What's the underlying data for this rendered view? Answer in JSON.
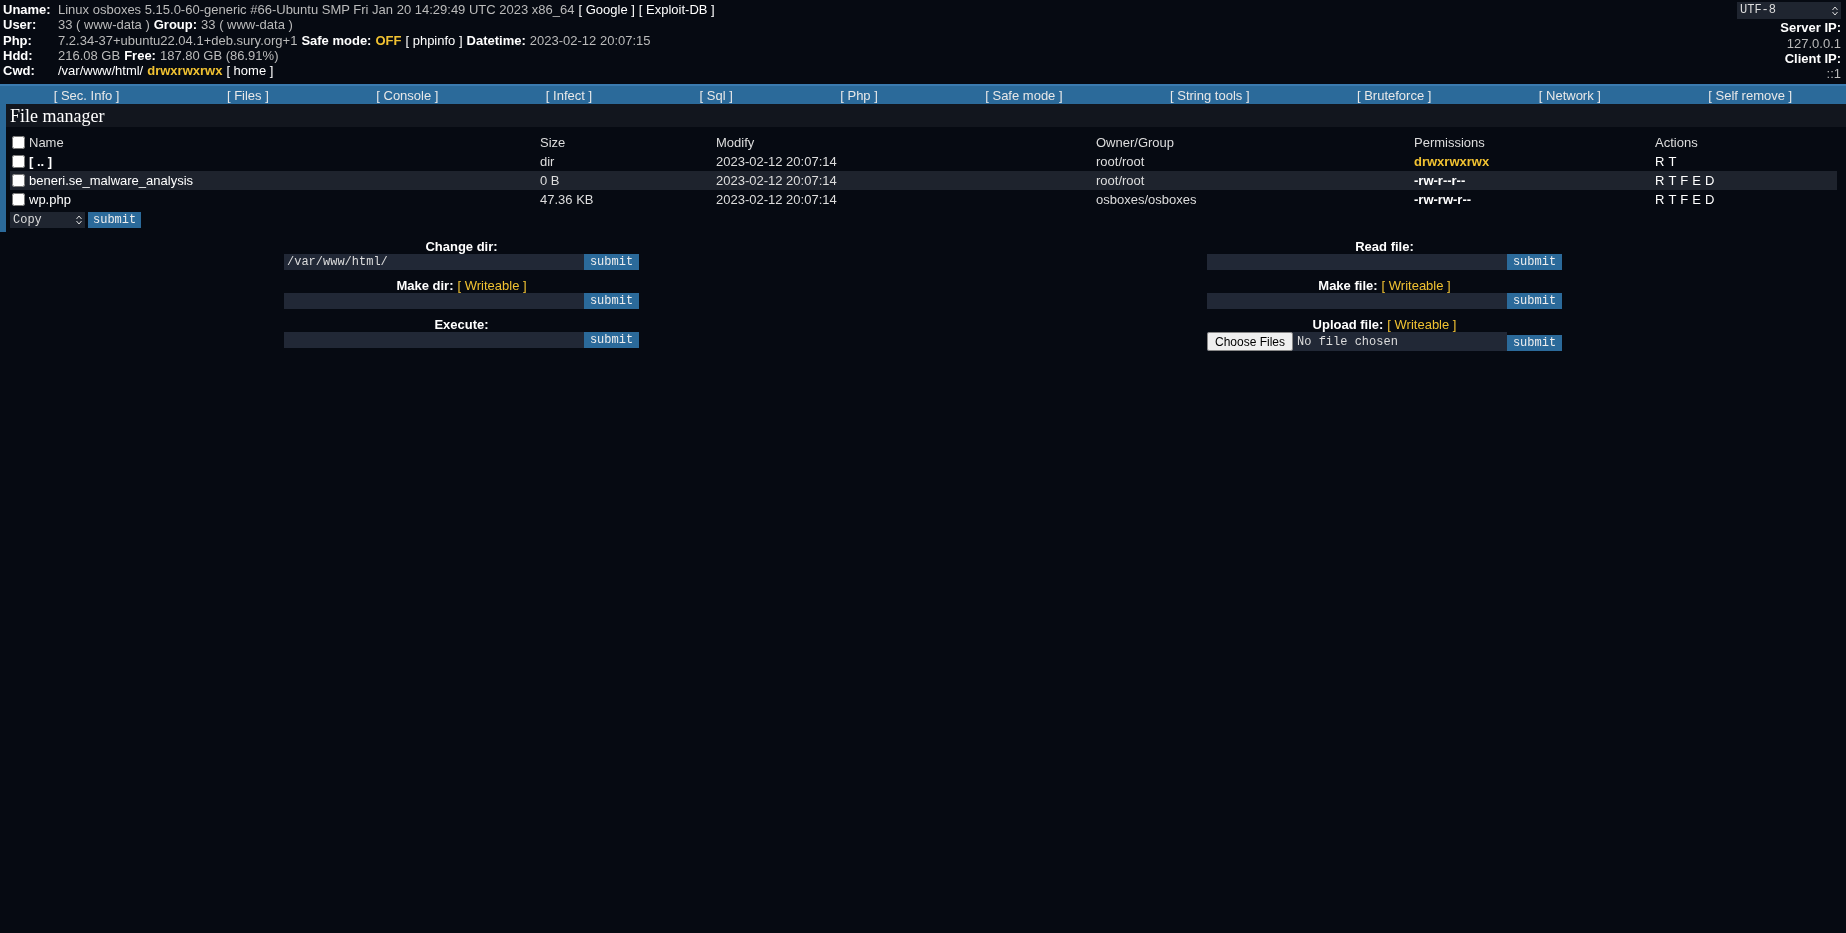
{
  "header": {
    "rows": [
      {
        "label": "Uname:",
        "parts": [
          {
            "kind": "text",
            "text": "Linux osboxes 5.15.0-60-generic #66-Ubuntu SMP Fri Jan 20 14:29:49 UTC 2023 x86_64"
          },
          {
            "kind": "link",
            "text": "[ Google ]"
          },
          {
            "kind": "link",
            "text": "[ Exploit-DB ]"
          }
        ]
      },
      {
        "label": "User:",
        "parts": [
          {
            "kind": "text",
            "text": "33 ( www-data )"
          },
          {
            "kind": "label",
            "text": "Group:"
          },
          {
            "kind": "text",
            "text": "33 ( www-data )"
          }
        ]
      },
      {
        "label": "Php:",
        "parts": [
          {
            "kind": "text",
            "text": "7.2.34-37+ubuntu22.04.1+deb.sury.org+1"
          },
          {
            "kind": "label",
            "text": "Safe mode:"
          },
          {
            "kind": "warn",
            "text": "OFF"
          },
          {
            "kind": "link",
            "text": "[ phpinfo ]"
          },
          {
            "kind": "label",
            "text": "Datetime:"
          },
          {
            "kind": "text",
            "text": "2023-02-12 20:07:15"
          }
        ]
      },
      {
        "label": "Hdd:",
        "parts": [
          {
            "kind": "text",
            "text": "216.08 GB"
          },
          {
            "kind": "label",
            "text": "Free:"
          },
          {
            "kind": "text",
            "text": "187.80 GB (86.91%)"
          }
        ]
      },
      {
        "label": "Cwd:",
        "parts": [
          {
            "kind": "link",
            "text": "/var/www/html/"
          },
          {
            "kind": "warn",
            "text": "drwxrwxrwx"
          },
          {
            "kind": "link",
            "text": "[ home ]"
          }
        ]
      }
    ],
    "charset": "UTF-8",
    "server_ip": {
      "label": "Server IP:",
      "value": "127.0.0.1"
    },
    "client_ip": {
      "label": "Client IP:",
      "value": "::1"
    }
  },
  "nav": [
    "[ Sec. Info ]",
    "[ Files ]",
    "[ Console ]",
    "[ Infect ]",
    "[ Sql ]",
    "[ Php ]",
    "[ Safe mode ]",
    "[ String tools ]",
    "[ Bruteforce ]",
    "[ Network ]",
    "[ Self remove ]"
  ],
  "file_manager": {
    "title": "File manager",
    "columns": [
      "Name",
      "Size",
      "Modify",
      "Owner/Group",
      "Permissions",
      "Actions"
    ],
    "select_all": {
      "checked": false
    },
    "rows": [
      {
        "name": "[ .. ]",
        "kind": "dir",
        "checked": false,
        "highlighted": false,
        "size": "dir",
        "modify": "2023-02-12 20:07:14",
        "owner": "root/root",
        "permissions": "drwxrwxrwx",
        "writable": true,
        "actions": [
          "R",
          "T"
        ]
      },
      {
        "name": "beneri.se_malware_analysis",
        "kind": "file",
        "checked": false,
        "highlighted": true,
        "size": "0 B",
        "modify": "2023-02-12 20:07:14",
        "owner": "root/root",
        "permissions": "-rw-r--r--",
        "writable": false,
        "actions": [
          "R",
          "T",
          "F",
          "E",
          "D"
        ]
      },
      {
        "name": "wp.php",
        "kind": "file",
        "checked": false,
        "highlighted": false,
        "size": "47.36 KB",
        "modify": "2023-02-12 20:07:14",
        "owner": "osboxes/osboxes",
        "permissions": "-rw-rw-r--",
        "writable": false,
        "actions": [
          "R",
          "T",
          "F",
          "E",
          "D"
        ]
      }
    ],
    "bulk_action": "Copy",
    "bulk_submit": "submit"
  },
  "forms": [
    [
      {
        "kind": "text",
        "label": "Change dir:",
        "input": {
          "value": "/var/www/html/"
        },
        "button": "submit"
      },
      {
        "kind": "text",
        "label": "Make dir:",
        "badge": "[ Writeable ]",
        "button": "submit"
      },
      {
        "kind": "text",
        "label": "Execute:",
        "button": "submit"
      }
    ],
    [
      {
        "kind": "text",
        "label": "Read file:",
        "button": "submit"
      },
      {
        "kind": "text",
        "label": "Make file:",
        "badge": "[ Writeable ]",
        "button": "submit"
      },
      {
        "kind": "file",
        "label": "Upload file:",
        "badge": "[ Writeable ]",
        "chooser": "Choose Files",
        "status": "No file chosen",
        "button": "submit"
      }
    ]
  ]
}
